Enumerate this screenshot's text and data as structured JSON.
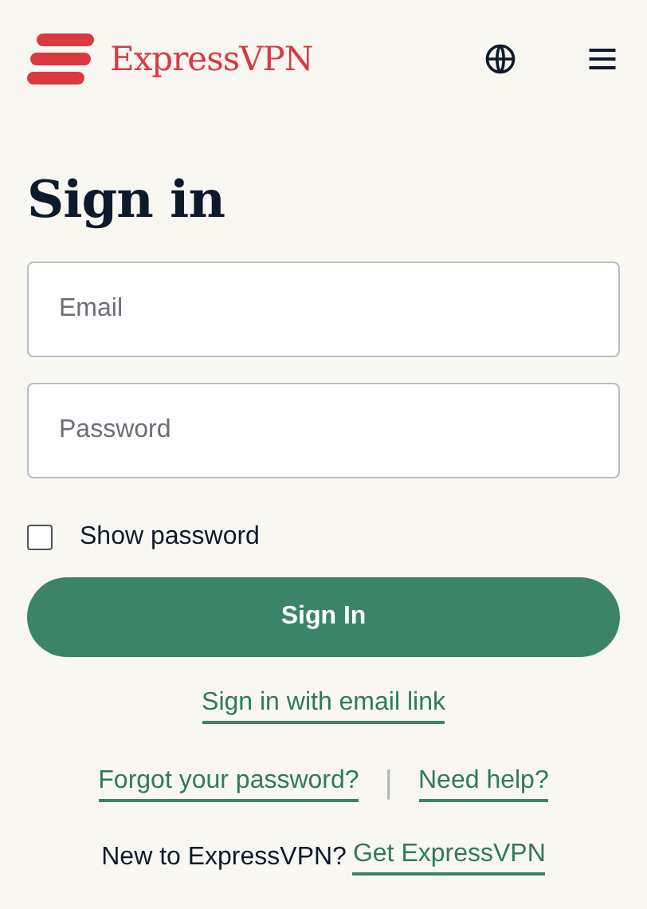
{
  "header": {
    "brand": "ExpressVPN"
  },
  "title": "Sign in",
  "fields": [
    {
      "placeholder": "Email"
    },
    {
      "placeholder": "Password"
    }
  ],
  "show_password": {
    "label": "Show password",
    "checked": false
  },
  "submit": "Sign In",
  "email_link": "Sign in with email link",
  "help_links": [
    "Forgot your password?",
    "Need help?"
  ],
  "separator": "|",
  "signup": {
    "text": "New to ExpressVPN?",
    "link": "Get ExpressVPN"
  }
}
